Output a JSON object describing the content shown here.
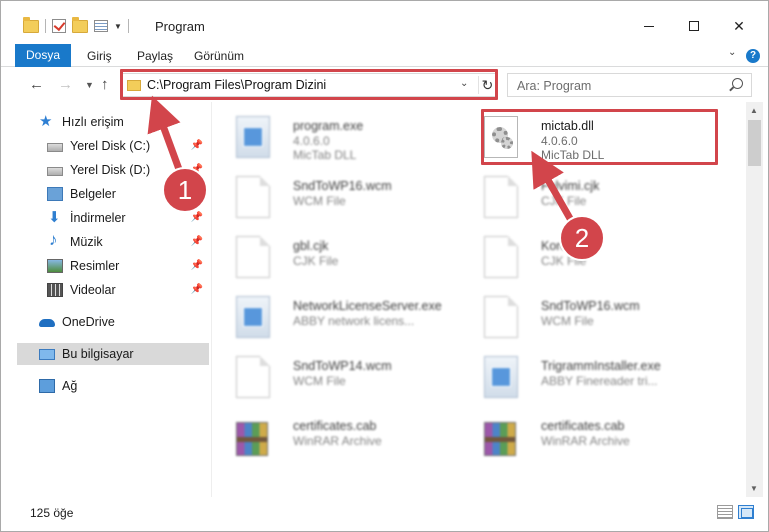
{
  "window": {
    "title": "Program",
    "minimize": "—",
    "close": "✕"
  },
  "ribbon": {
    "tabs": [
      "Dosya",
      "Giriş",
      "Paylaş",
      "Görünüm"
    ],
    "help": "?"
  },
  "navigation": {
    "address": "C:\\Program Files\\Program Dizini",
    "refresh": "↻",
    "search_placeholder": "Ara: Program",
    "back": "←",
    "forward": "→",
    "up": "↑"
  },
  "sidebar": {
    "items": [
      {
        "label": "Hızlı erişim",
        "icon": "star-icon",
        "pinned": false
      },
      {
        "label": "Yerel Disk (C:)",
        "icon": "drive-icon",
        "pinned": true
      },
      {
        "label": "Yerel Disk (D:)",
        "icon": "drive-icon",
        "pinned": true
      },
      {
        "label": "Belgeler",
        "icon": "documents-folder-icon",
        "pinned": true
      },
      {
        "label": "İndirmeler",
        "icon": "download-icon",
        "pinned": true
      },
      {
        "label": "Müzik",
        "icon": "music-icon",
        "pinned": true
      },
      {
        "label": "Resimler",
        "icon": "pictures-icon",
        "pinned": true
      },
      {
        "label": "Videolar",
        "icon": "videos-icon",
        "pinned": true
      },
      {
        "label": "OneDrive",
        "icon": "onedrive-icon",
        "pinned": false
      },
      {
        "label": "Bu bilgisayar",
        "icon": "computer-icon",
        "pinned": false,
        "selected": true
      },
      {
        "label": "Ağ",
        "icon": "network-icon",
        "pinned": false
      }
    ],
    "pin_glyph": "📌"
  },
  "files": [
    {
      "name": "program.exe",
      "line1": "4.0.6.0",
      "line2": "MicTab DLL",
      "type": "exe",
      "blurred": true
    },
    {
      "name": "mictab.dll",
      "line1": "4.0.6.0",
      "line2": "MicTab DLL",
      "type": "dll",
      "blurred": false
    },
    {
      "name": "SndToWP16.wcm",
      "line1": "WCM File",
      "line2": "",
      "type": "doc",
      "blurred": true
    },
    {
      "name": "Felvimi.cjk",
      "line1": "CJK File",
      "line2": "",
      "type": "doc",
      "blurred": true
    },
    {
      "name": "gbl.cjk",
      "line1": "CJK File",
      "line2": "",
      "type": "doc",
      "blurred": true
    },
    {
      "name": "Korean.cjk",
      "line1": "CJK File",
      "line2": "",
      "type": "doc",
      "blurred": true
    },
    {
      "name": "NetworkLicenseServer.exe",
      "line1": "ABBY network licens...",
      "line2": "",
      "type": "exe",
      "blurred": true
    },
    {
      "name": "SndToWP16.wcm",
      "line1": "WCM File",
      "line2": "",
      "type": "doc",
      "blurred": true
    },
    {
      "name": "SndToWP14.wcm",
      "line1": "WCM File",
      "line2": "",
      "type": "doc",
      "blurred": true
    },
    {
      "name": "TrigrammInstaller.exe",
      "line1": "ABBY Finereader tri...",
      "line2": "",
      "type": "exe",
      "blurred": true
    },
    {
      "name": "certificates.cab",
      "line1": "WinRAR Archive",
      "line2": "",
      "type": "cab",
      "blurred": true
    },
    {
      "name": "certificates.cab",
      "line1": "WinRAR Archive",
      "line2": "",
      "type": "cab",
      "blurred": true
    }
  ],
  "status": {
    "item_count": "125 öğe"
  },
  "annotations": {
    "marker_1": "1",
    "marker_2": "2",
    "color": "#d2454b"
  },
  "colors": {
    "accent": "#1979ca",
    "annotation": "#d2454b",
    "selection": "#d9d9d9"
  }
}
